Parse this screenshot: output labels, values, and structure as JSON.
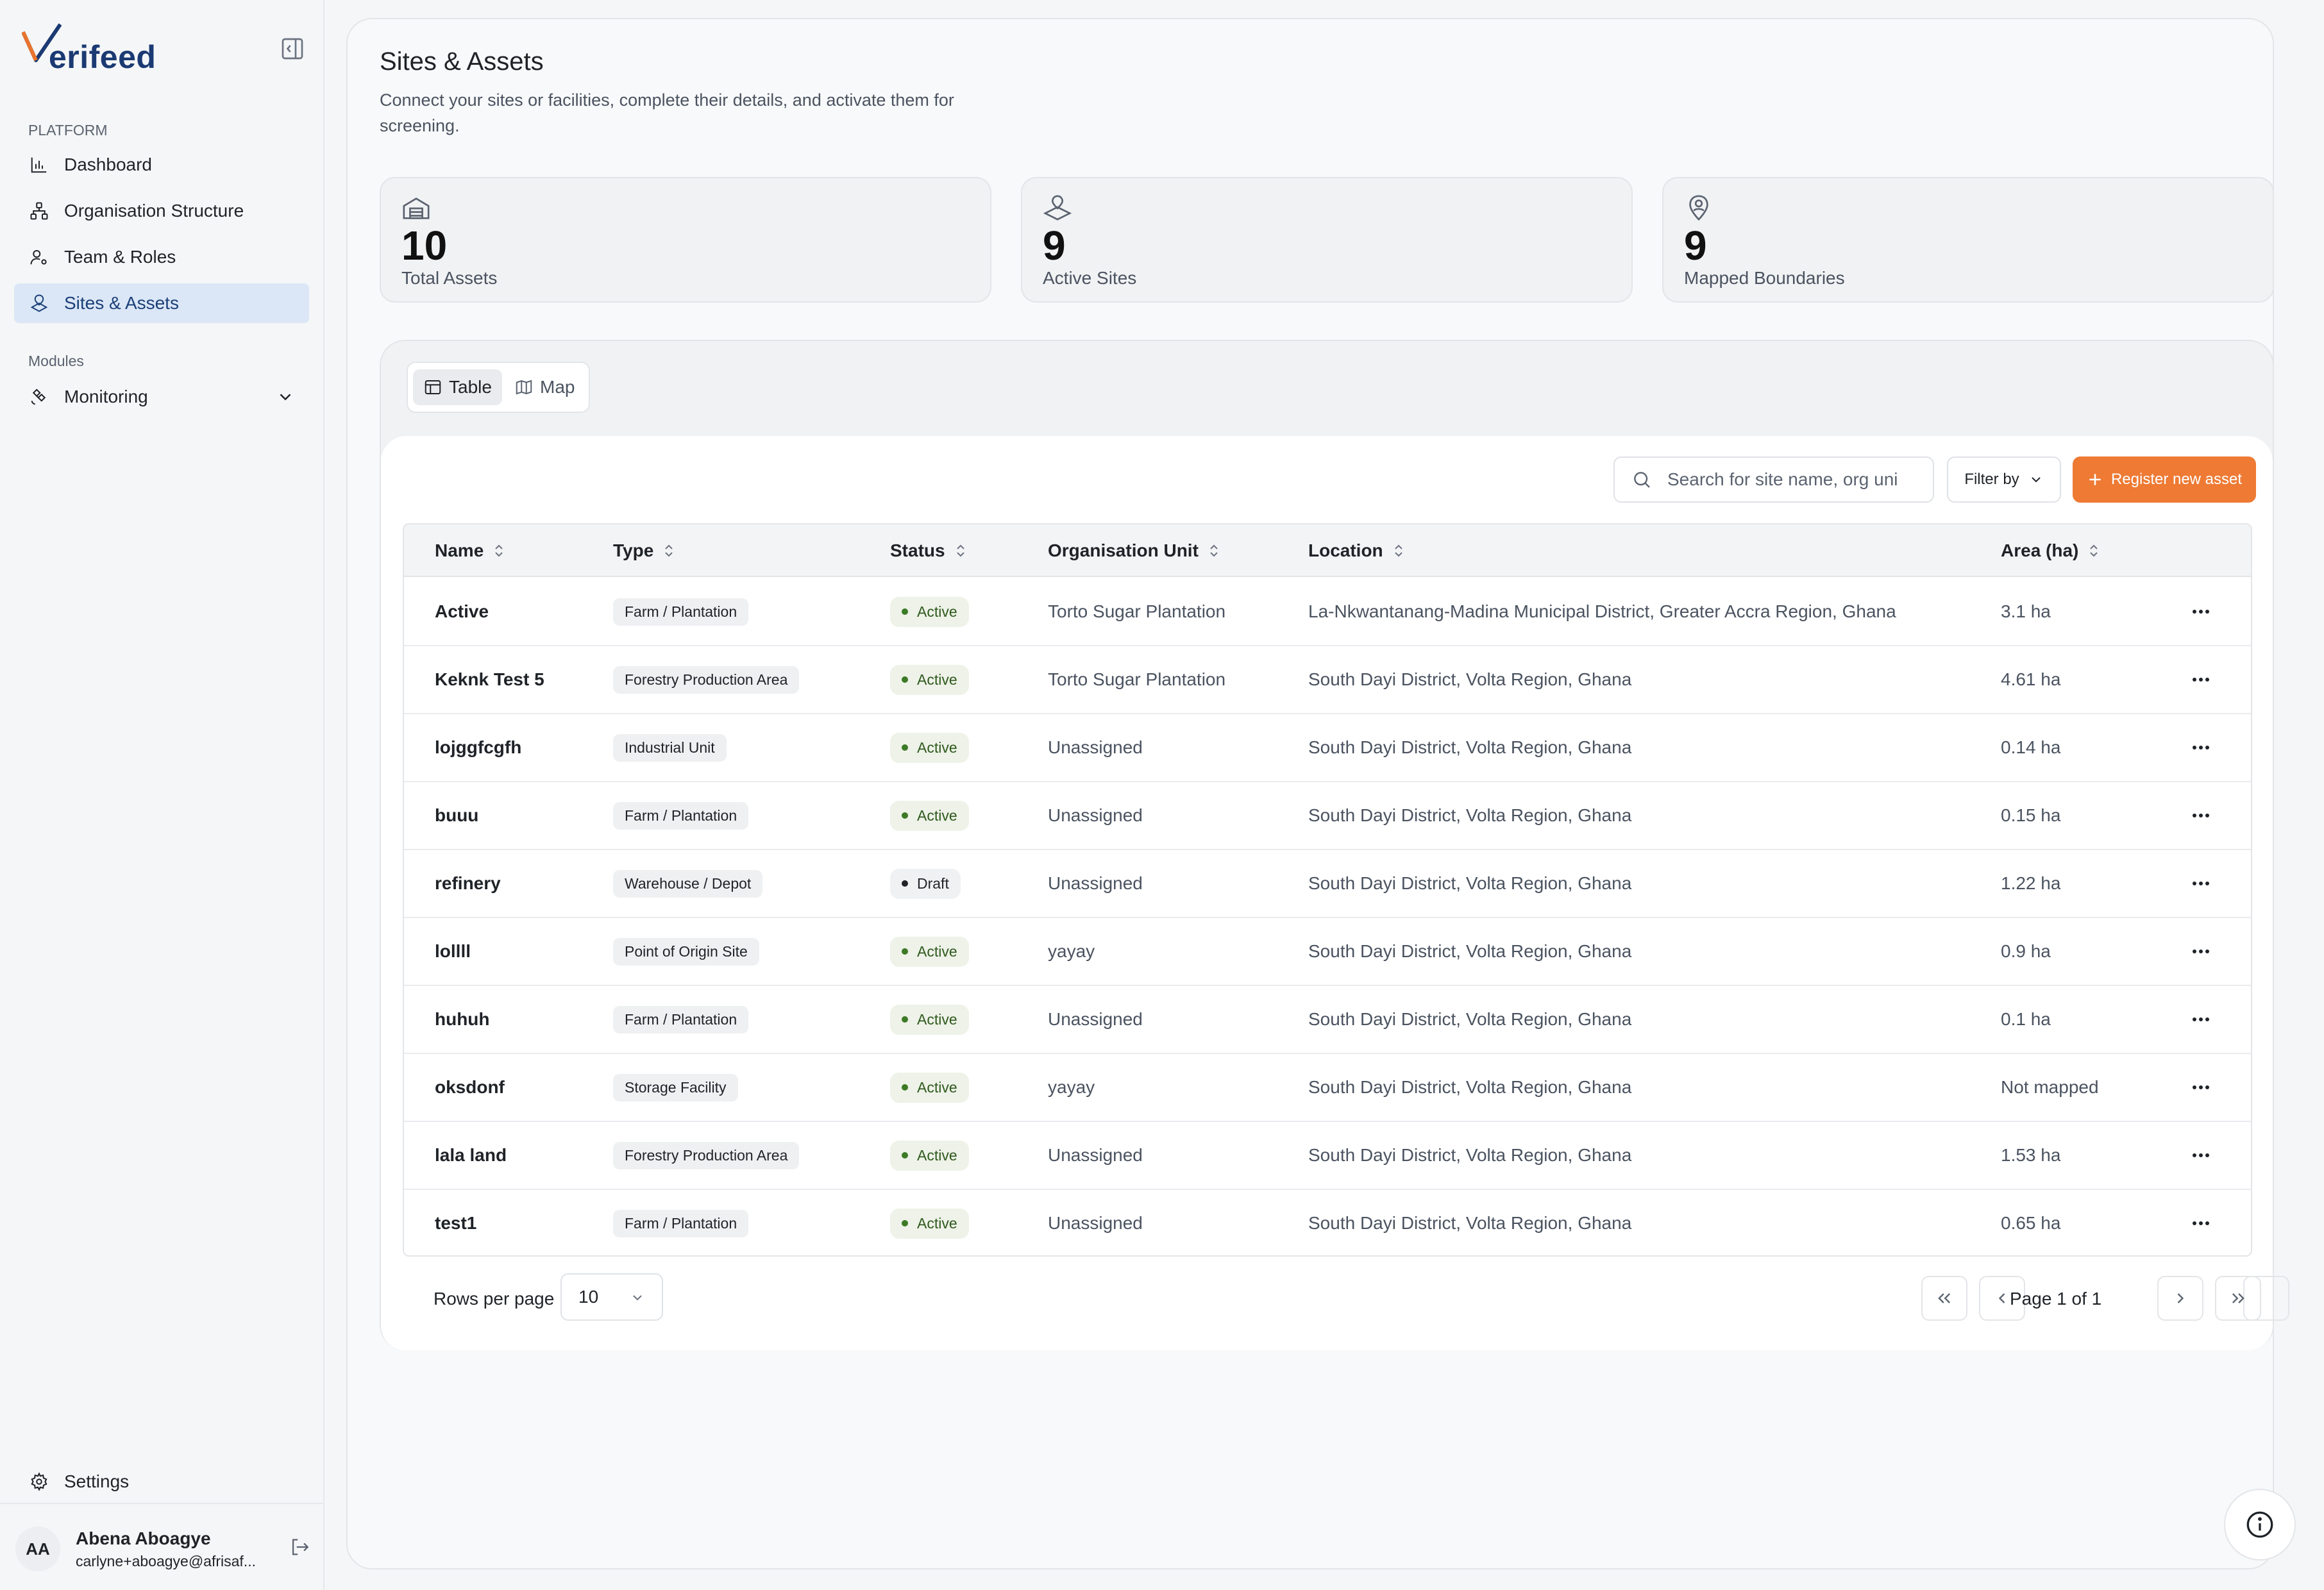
{
  "app": {
    "logo_text": "erifeed"
  },
  "sidebar": {
    "platform_label": "PLATFORM",
    "modules_label": "Modules",
    "items": [
      {
        "label": "Dashboard",
        "icon": "bar-chart-icon"
      },
      {
        "label": "Organisation Structure",
        "icon": "org-tree-icon"
      },
      {
        "label": "Team & Roles",
        "icon": "user-cog-icon"
      },
      {
        "label": "Sites & Assets",
        "icon": "site-pin-icon",
        "active": true
      }
    ],
    "modules": [
      {
        "label": "Monitoring",
        "icon": "satellite-icon"
      }
    ],
    "settings_label": "Settings",
    "user": {
      "initials": "AA",
      "name": "Abena Aboagye",
      "email": "carlyne+aboagye@afrisaf..."
    }
  },
  "header": {
    "title": "Sites & Assets",
    "subtitle": "Connect your sites or facilities, complete their details, and activate them for screening."
  },
  "stats": [
    {
      "value": "10",
      "label": "Total Assets",
      "icon": "warehouse-icon"
    },
    {
      "value": "9",
      "label": "Active Sites",
      "icon": "map-pin-plot-icon"
    },
    {
      "value": "9",
      "label": "Mapped Boundaries",
      "icon": "location-user-icon"
    }
  ],
  "view_toggle": {
    "table_label": "Table",
    "map_label": "Map"
  },
  "toolbar": {
    "search_placeholder": "Search for site name, org uni",
    "filter_label": "Filter by",
    "register_label": "Register new asset"
  },
  "table": {
    "columns": [
      "Name",
      "Type",
      "Status",
      "Organisation Unit",
      "Location",
      "Area (ha)"
    ],
    "rows": [
      {
        "name": "Active",
        "type": "Farm / Plantation",
        "status": "Active",
        "org_unit": "Torto Sugar Plantation",
        "location": "La-Nkwantanang-Madina Municipal District, Greater Accra Region, Ghana",
        "area": "3.1 ha"
      },
      {
        "name": "Keknk Test 5",
        "type": "Forestry Production Area",
        "status": "Active",
        "org_unit": "Torto Sugar Plantation",
        "location": "South Dayi District, Volta Region, Ghana",
        "area": "4.61 ha"
      },
      {
        "name": "lojggfcgfh",
        "type": "Industrial Unit",
        "status": "Active",
        "org_unit": "Unassigned",
        "location": "South Dayi District, Volta Region, Ghana",
        "area": "0.14 ha"
      },
      {
        "name": "buuu",
        "type": "Farm / Plantation",
        "status": "Active",
        "org_unit": "Unassigned",
        "location": "South Dayi District, Volta Region, Ghana",
        "area": "0.15 ha"
      },
      {
        "name": "refinery",
        "type": "Warehouse / Depot",
        "status": "Draft",
        "org_unit": "Unassigned",
        "location": "South Dayi District, Volta Region, Ghana",
        "area": "1.22 ha"
      },
      {
        "name": "lollll",
        "type": "Point of Origin Site",
        "status": "Active",
        "org_unit": "yayay",
        "location": "South Dayi District, Volta Region, Ghana",
        "area": "0.9 ha"
      },
      {
        "name": "huhuh",
        "type": "Farm / Plantation",
        "status": "Active",
        "org_unit": "Unassigned",
        "location": "South Dayi District, Volta Region, Ghana",
        "area": "0.1 ha"
      },
      {
        "name": "oksdonf",
        "type": "Storage Facility",
        "status": "Active",
        "org_unit": "yayay",
        "location": "South Dayi District, Volta Region, Ghana",
        "area": "Not mapped"
      },
      {
        "name": "lala land",
        "type": "Forestry Production Area",
        "status": "Active",
        "org_unit": "Unassigned",
        "location": "South Dayi District, Volta Region, Ghana",
        "area": "1.53 ha"
      },
      {
        "name": "test1",
        "type": "Farm / Plantation",
        "status": "Active",
        "org_unit": "Unassigned",
        "location": "South Dayi District, Volta Region, Ghana",
        "area": "0.65 ha"
      }
    ]
  },
  "pagination": {
    "rows_per_page_label": "Rows per page",
    "rows_per_page_value": "10",
    "page_text": "Page 1 of 1"
  },
  "colors": {
    "accent": "#ee7a34",
    "brand": "#1b3a73",
    "active_nav_bg": "#dbe7f6"
  }
}
